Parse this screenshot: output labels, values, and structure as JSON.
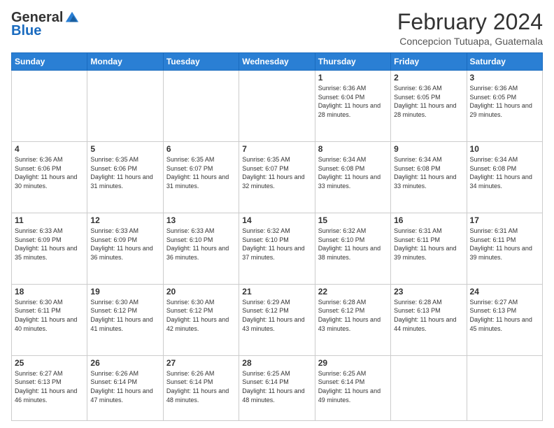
{
  "logo": {
    "general": "General",
    "blue": "Blue"
  },
  "header": {
    "title": "February 2024",
    "subtitle": "Concepcion Tutuapa, Guatemala"
  },
  "weekdays": [
    "Sunday",
    "Monday",
    "Tuesday",
    "Wednesday",
    "Thursday",
    "Friday",
    "Saturday"
  ],
  "weeks": [
    [
      {
        "day": "",
        "info": ""
      },
      {
        "day": "",
        "info": ""
      },
      {
        "day": "",
        "info": ""
      },
      {
        "day": "",
        "info": ""
      },
      {
        "day": "1",
        "info": "Sunrise: 6:36 AM\nSunset: 6:04 PM\nDaylight: 11 hours and 28 minutes."
      },
      {
        "day": "2",
        "info": "Sunrise: 6:36 AM\nSunset: 6:05 PM\nDaylight: 11 hours and 28 minutes."
      },
      {
        "day": "3",
        "info": "Sunrise: 6:36 AM\nSunset: 6:05 PM\nDaylight: 11 hours and 29 minutes."
      }
    ],
    [
      {
        "day": "4",
        "info": "Sunrise: 6:36 AM\nSunset: 6:06 PM\nDaylight: 11 hours and 30 minutes."
      },
      {
        "day": "5",
        "info": "Sunrise: 6:35 AM\nSunset: 6:06 PM\nDaylight: 11 hours and 31 minutes."
      },
      {
        "day": "6",
        "info": "Sunrise: 6:35 AM\nSunset: 6:07 PM\nDaylight: 11 hours and 31 minutes."
      },
      {
        "day": "7",
        "info": "Sunrise: 6:35 AM\nSunset: 6:07 PM\nDaylight: 11 hours and 32 minutes."
      },
      {
        "day": "8",
        "info": "Sunrise: 6:34 AM\nSunset: 6:08 PM\nDaylight: 11 hours and 33 minutes."
      },
      {
        "day": "9",
        "info": "Sunrise: 6:34 AM\nSunset: 6:08 PM\nDaylight: 11 hours and 33 minutes."
      },
      {
        "day": "10",
        "info": "Sunrise: 6:34 AM\nSunset: 6:08 PM\nDaylight: 11 hours and 34 minutes."
      }
    ],
    [
      {
        "day": "11",
        "info": "Sunrise: 6:33 AM\nSunset: 6:09 PM\nDaylight: 11 hours and 35 minutes."
      },
      {
        "day": "12",
        "info": "Sunrise: 6:33 AM\nSunset: 6:09 PM\nDaylight: 11 hours and 36 minutes."
      },
      {
        "day": "13",
        "info": "Sunrise: 6:33 AM\nSunset: 6:10 PM\nDaylight: 11 hours and 36 minutes."
      },
      {
        "day": "14",
        "info": "Sunrise: 6:32 AM\nSunset: 6:10 PM\nDaylight: 11 hours and 37 minutes."
      },
      {
        "day": "15",
        "info": "Sunrise: 6:32 AM\nSunset: 6:10 PM\nDaylight: 11 hours and 38 minutes."
      },
      {
        "day": "16",
        "info": "Sunrise: 6:31 AM\nSunset: 6:11 PM\nDaylight: 11 hours and 39 minutes."
      },
      {
        "day": "17",
        "info": "Sunrise: 6:31 AM\nSunset: 6:11 PM\nDaylight: 11 hours and 39 minutes."
      }
    ],
    [
      {
        "day": "18",
        "info": "Sunrise: 6:30 AM\nSunset: 6:11 PM\nDaylight: 11 hours and 40 minutes."
      },
      {
        "day": "19",
        "info": "Sunrise: 6:30 AM\nSunset: 6:12 PM\nDaylight: 11 hours and 41 minutes."
      },
      {
        "day": "20",
        "info": "Sunrise: 6:30 AM\nSunset: 6:12 PM\nDaylight: 11 hours and 42 minutes."
      },
      {
        "day": "21",
        "info": "Sunrise: 6:29 AM\nSunset: 6:12 PM\nDaylight: 11 hours and 43 minutes."
      },
      {
        "day": "22",
        "info": "Sunrise: 6:28 AM\nSunset: 6:12 PM\nDaylight: 11 hours and 43 minutes."
      },
      {
        "day": "23",
        "info": "Sunrise: 6:28 AM\nSunset: 6:13 PM\nDaylight: 11 hours and 44 minutes."
      },
      {
        "day": "24",
        "info": "Sunrise: 6:27 AM\nSunset: 6:13 PM\nDaylight: 11 hours and 45 minutes."
      }
    ],
    [
      {
        "day": "25",
        "info": "Sunrise: 6:27 AM\nSunset: 6:13 PM\nDaylight: 11 hours and 46 minutes."
      },
      {
        "day": "26",
        "info": "Sunrise: 6:26 AM\nSunset: 6:14 PM\nDaylight: 11 hours and 47 minutes."
      },
      {
        "day": "27",
        "info": "Sunrise: 6:26 AM\nSunset: 6:14 PM\nDaylight: 11 hours and 48 minutes."
      },
      {
        "day": "28",
        "info": "Sunrise: 6:25 AM\nSunset: 6:14 PM\nDaylight: 11 hours and 48 minutes."
      },
      {
        "day": "29",
        "info": "Sunrise: 6:25 AM\nSunset: 6:14 PM\nDaylight: 11 hours and 49 minutes."
      },
      {
        "day": "",
        "info": ""
      },
      {
        "day": "",
        "info": ""
      }
    ]
  ]
}
